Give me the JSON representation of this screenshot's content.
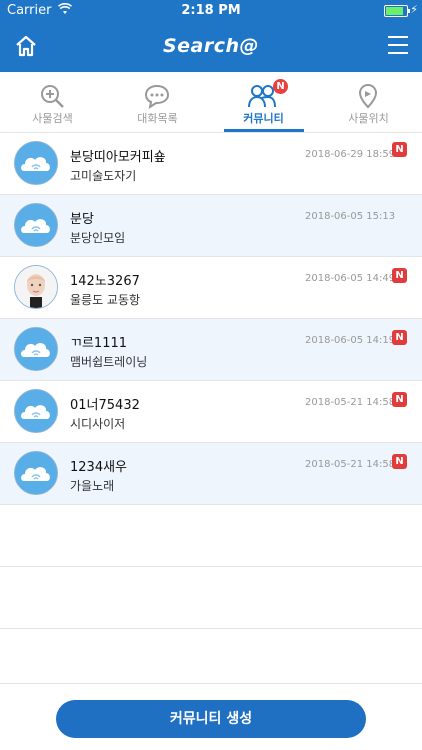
{
  "status_bar": {
    "carrier": "Carrier",
    "time": "2:18 PM"
  },
  "nav": {
    "logo": "Search@",
    "home_icon": "home-icon",
    "menu_icon": "menu-icon"
  },
  "tabs": [
    {
      "label": "사물검색",
      "icon": "search-plus-icon",
      "active": false
    },
    {
      "label": "대화목록",
      "icon": "chat-icon",
      "active": false
    },
    {
      "label": "커뮤니티",
      "icon": "people-icon",
      "active": true,
      "badge": "N"
    },
    {
      "label": "사물위치",
      "icon": "location-pin-icon",
      "active": false
    }
  ],
  "rows": [
    {
      "title": "분당띠아모커피숖",
      "subtitle": "고미술도자기",
      "date": "2018-06-29 18:59",
      "badge": "N",
      "avatar": "cloud"
    },
    {
      "title": "분당",
      "subtitle": "분당인모임",
      "date": "2018-06-05 15:13",
      "badge": "",
      "avatar": "cloud"
    },
    {
      "title": "142노3267",
      "subtitle": "울릉도 교동항",
      "date": "2018-06-05 14:49",
      "badge": "N",
      "avatar": "face"
    },
    {
      "title": "ㄲ르1111",
      "subtitle": "맴버쉽트레이닝",
      "date": "2018-06-05 14:19",
      "badge": "N",
      "avatar": "cloud"
    },
    {
      "title": "01너75432",
      "subtitle": "시디사이저",
      "date": "2018-05-21 14:58",
      "badge": "N",
      "avatar": "cloud"
    },
    {
      "title": "1234새우",
      "subtitle": "가을노래",
      "date": "2018-05-21 14:58",
      "badge": "N",
      "avatar": "cloud"
    }
  ],
  "create_button": "커뮤니티 생성",
  "colors": {
    "primary": "#1f76c7",
    "badge": "#e23b3b",
    "row_alt": "#eef5fc"
  }
}
